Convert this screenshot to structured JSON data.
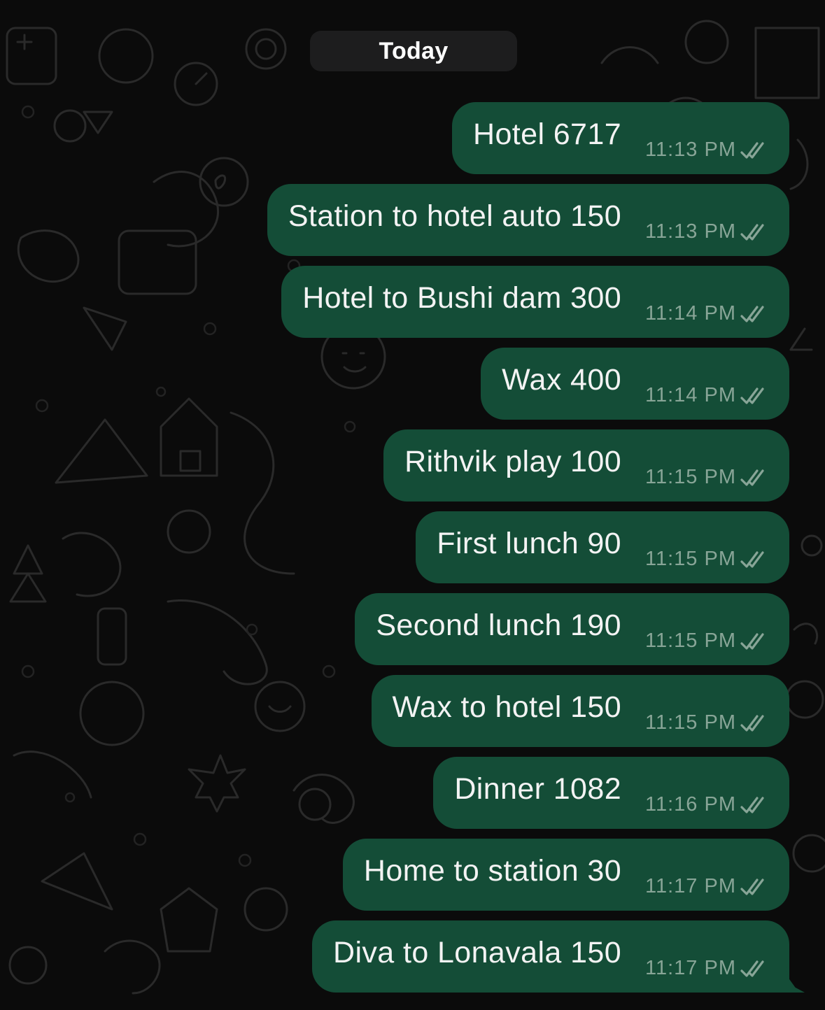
{
  "date_separator": "Today",
  "colors": {
    "background": "#0b0b0b",
    "bubble_outgoing": "#144d37",
    "text": "#f3f3f3",
    "time": "#88a597",
    "date_pill": "#1d1d1e"
  },
  "messages": [
    {
      "text": "Hotel 6717",
      "time": "11:13 PM",
      "status_icon": "double-check-icon"
    },
    {
      "text": "Station to hotel auto 150",
      "time": "11:13 PM",
      "status_icon": "double-check-icon"
    },
    {
      "text": "Hotel to Bushi dam 300",
      "time": "11:14 PM",
      "status_icon": "double-check-icon"
    },
    {
      "text": "Wax 400",
      "time": "11:14 PM",
      "status_icon": "double-check-icon"
    },
    {
      "text": "Rithvik play 100",
      "time": "11:15 PM",
      "status_icon": "double-check-icon"
    },
    {
      "text": "First lunch 90",
      "time": "11:15 PM",
      "status_icon": "double-check-icon"
    },
    {
      "text": "Second lunch 190",
      "time": "11:15 PM",
      "status_icon": "double-check-icon"
    },
    {
      "text": "Wax to hotel 150",
      "time": "11:15 PM",
      "status_icon": "double-check-icon"
    },
    {
      "text": "Dinner 1082",
      "time": "11:16 PM",
      "status_icon": "double-check-icon"
    },
    {
      "text": "Home to station 30",
      "time": "11:17 PM",
      "status_icon": "double-check-icon"
    },
    {
      "text": "Diva to Lonavala 150",
      "time": "11:17 PM",
      "status_icon": "double-check-icon"
    }
  ]
}
